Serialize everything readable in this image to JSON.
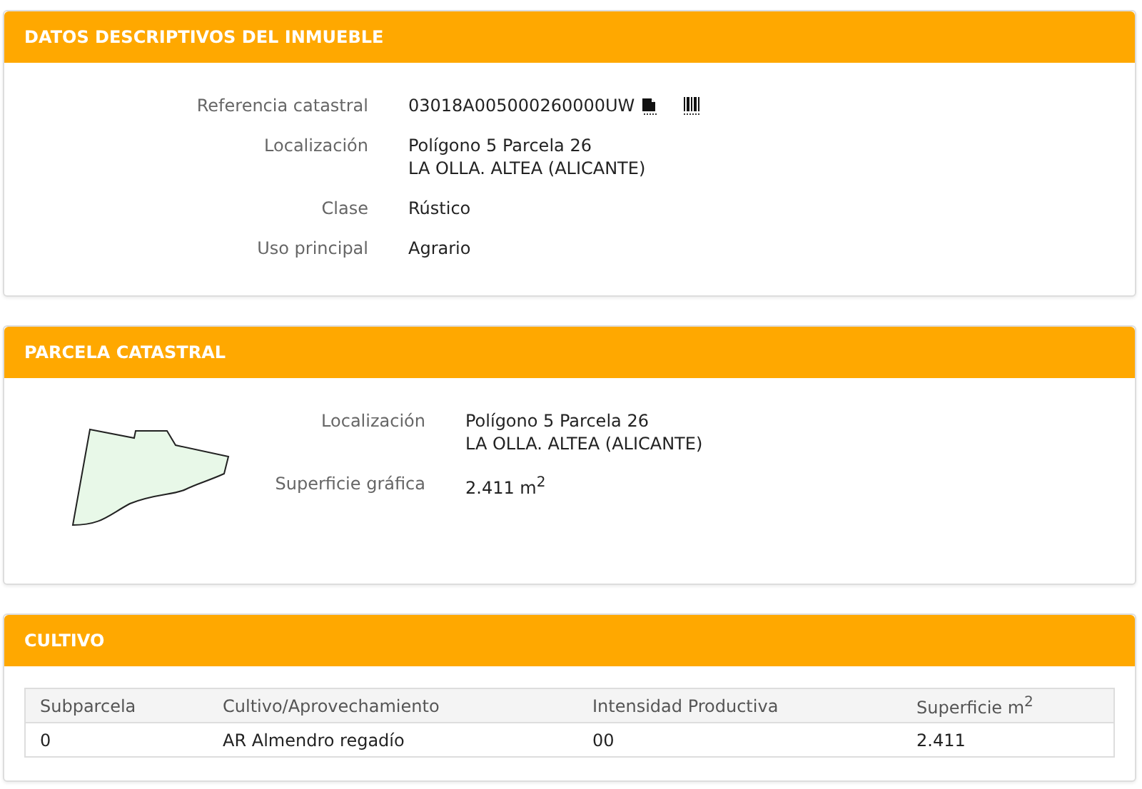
{
  "datos": {
    "title": "DATOS DESCRIPTIVOS DEL INMUEBLE",
    "fields": [
      {
        "kind": "ref",
        "label": "Referencia catastral",
        "lines": [
          "03018A005000260000UW"
        ]
      },
      {
        "kind": "text",
        "label": "Localización",
        "lines": [
          "Polígono 5 Parcela 26",
          "LA OLLA. ALTEA (ALICANTE)"
        ]
      },
      {
        "kind": "text",
        "label": "Clase",
        "lines": [
          "Rústico"
        ]
      },
      {
        "kind": "text",
        "label": "Uso principal",
        "lines": [
          "Agrario"
        ]
      }
    ]
  },
  "parcela": {
    "title": "PARCELA CATASTRAL",
    "fields": [
      {
        "label": "Localización",
        "lines": [
          "Polígono 5 Parcela 26",
          "LA OLLA. ALTEA (ALICANTE)"
        ]
      },
      {
        "label": "Superficie gráfica",
        "lines": [
          "2.411 m$^{2}$"
        ]
      }
    ]
  },
  "cultivo": {
    "title": "CULTIVO",
    "columns": [
      "Subparcela",
      "Cultivo/Aprovechamiento",
      "Intensidad Productiva",
      "Superficie m$^{2}$"
    ],
    "rows": [
      [
        "0",
        "AR Almendro regadío",
        "00",
        "2.411"
      ]
    ]
  }
}
